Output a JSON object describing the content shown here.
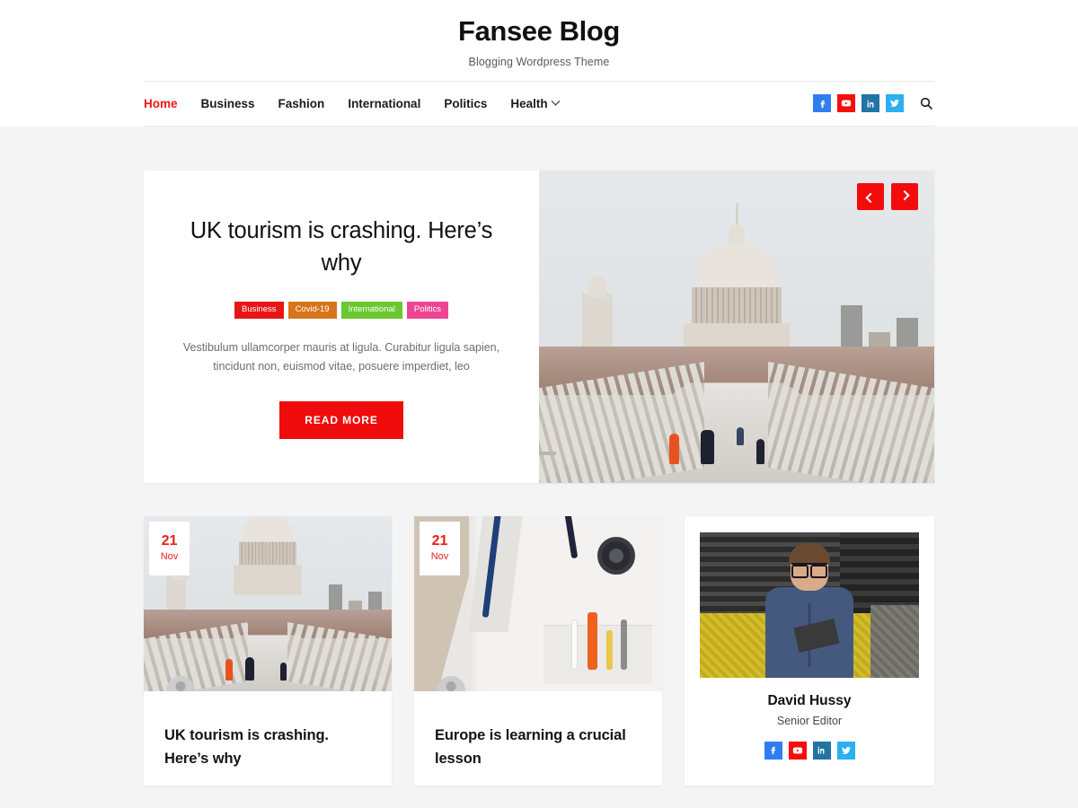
{
  "header": {
    "title": "Fansee Blog",
    "tagline": "Blogging Wordpress Theme"
  },
  "nav": {
    "items": [
      {
        "label": "Home",
        "active": true,
        "dropdown": false
      },
      {
        "label": "Business",
        "active": false,
        "dropdown": false
      },
      {
        "label": "Fashion",
        "active": false,
        "dropdown": false
      },
      {
        "label": "International",
        "active": false,
        "dropdown": false
      },
      {
        "label": "Politics",
        "active": false,
        "dropdown": false
      },
      {
        "label": "Health",
        "active": false,
        "dropdown": true
      }
    ],
    "social": [
      {
        "name": "facebook",
        "color": "#2f7ef0"
      },
      {
        "name": "youtube",
        "color": "#fb0c0c"
      },
      {
        "name": "linkedin",
        "color": "#2174a3"
      },
      {
        "name": "twitter",
        "color": "#2bb0f0"
      }
    ],
    "search_icon": "search-icon"
  },
  "hero": {
    "title": "UK tourism is crashing. Here’s why",
    "tags": [
      {
        "label": "Business",
        "color": "#e81515"
      },
      {
        "label": "Covid-19",
        "color": "#d7751c"
      },
      {
        "label": "International",
        "color": "#6ac72f"
      },
      {
        "label": "Politics",
        "color": "#ef4494"
      }
    ],
    "description": "Vestibulum ullamcorper mauris at ligula. Curabitur ligula sapien, tincidunt non, euismod vitae, posuere imperdiet, leo",
    "read_more_label": "READ MORE",
    "prev_icon": "chevron-left-icon",
    "next_icon": "chevron-right-icon",
    "image_alt": "St Paul's Cathedral seen from the Millennium Bridge with pedestrians",
    "pagination": [
      {
        "active": true
      },
      {
        "active": false
      }
    ]
  },
  "posts": [
    {
      "date_day": "21",
      "date_month": "Nov",
      "title": "UK tourism is crashing. Here’s why",
      "image_alt": "St Paul's Cathedral seen from the Millennium Bridge"
    },
    {
      "date_day": "21",
      "date_month": "Nov",
      "title": "Europe is learning a crucial lesson",
      "image_alt": "Doctor's white coat with stethoscope and pens in pocket"
    }
  ],
  "author": {
    "name": "David Hussy",
    "role": "Senior Editor",
    "photo_alt": "Man with glasses in a denim shirt sitting on a yellow couch writing",
    "social": [
      {
        "name": "facebook",
        "color": "#2f7ef0"
      },
      {
        "name": "youtube",
        "color": "#fb0c0c"
      },
      {
        "name": "linkedin",
        "color": "#2174a3"
      },
      {
        "name": "twitter",
        "color": "#2bb0f0"
      }
    ]
  },
  "theme": {
    "accent": "#f41612",
    "page_bg": "#f4f4f4",
    "card_bg": "#ffffff"
  }
}
